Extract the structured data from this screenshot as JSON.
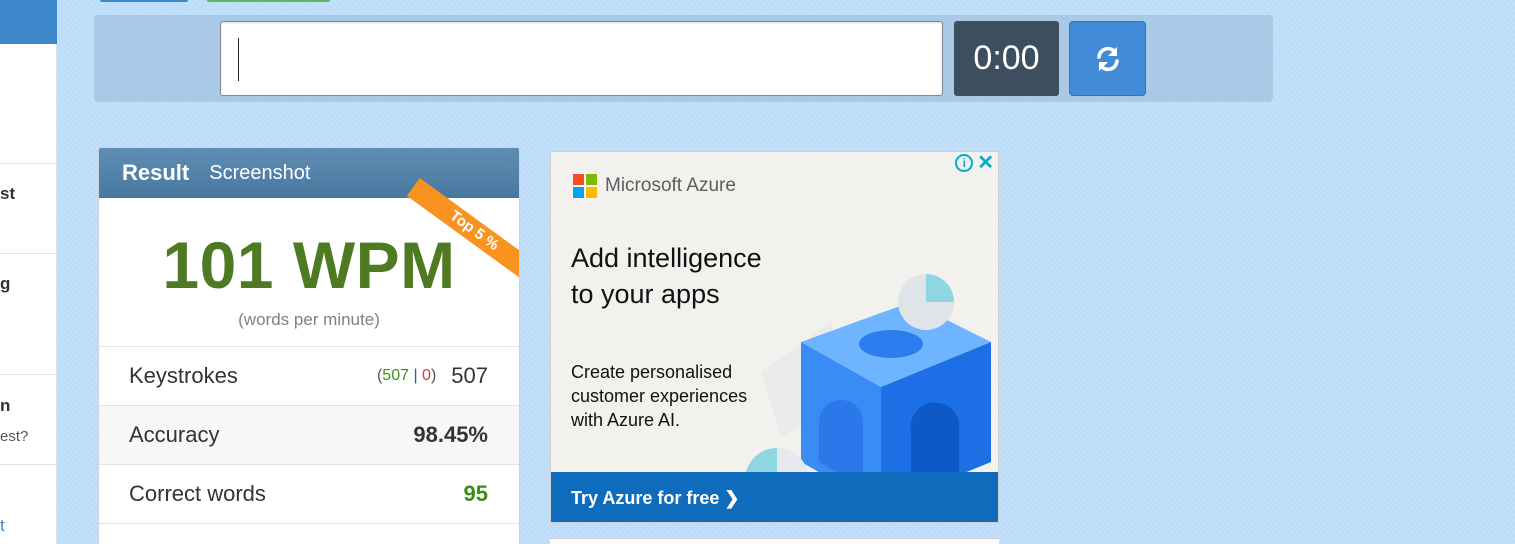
{
  "sidebar": {
    "fragments": [
      "st",
      "g",
      "n",
      "est?",
      "t"
    ]
  },
  "timer": {
    "value": "0:00"
  },
  "input": {
    "value": ""
  },
  "result": {
    "tabs": [
      "Result",
      "Screenshot"
    ],
    "wpm": "101 WPM",
    "wpm_caption": "(words per minute)",
    "badge": "Top 5 %",
    "keystrokes": {
      "label": "Keystrokes",
      "open": "(",
      "correct": "507",
      "sep": " | ",
      "wrong": "0",
      "close": ")",
      "total": "507"
    },
    "accuracy": {
      "label": "Accuracy",
      "value": "98.45%"
    },
    "correct_words": {
      "label": "Correct words",
      "value": "95"
    }
  },
  "ad": {
    "brand": "Microsoft Azure",
    "headline": "Add intelligence to your apps",
    "body": "Create personalised customer experiences with Azure AI.",
    "cta": "Try Azure for free ❯",
    "info_glyph": "i",
    "close_glyph": "✕",
    "logo_colors": [
      "#f25022",
      "#7fba00",
      "#00a4ef",
      "#ffb900"
    ]
  },
  "colors": {
    "page_bg": "#bcdcfa",
    "wpm_green": "#4d7a23",
    "ribbon_orange": "#f7931e",
    "timer_bg": "#3d4e5e",
    "reload_blue": "#428bd6"
  }
}
